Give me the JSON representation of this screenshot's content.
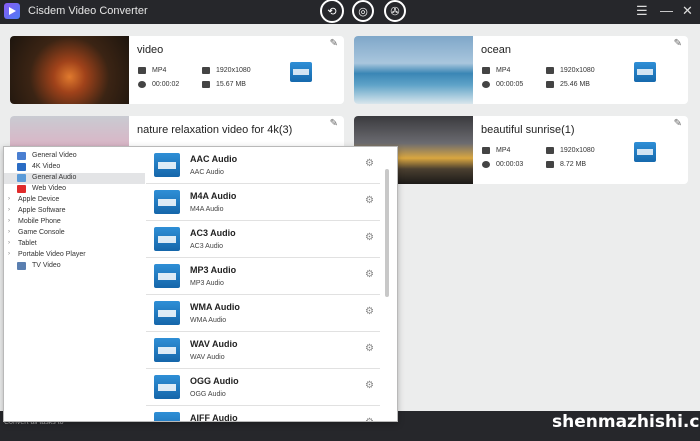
{
  "app": {
    "title": "Cisdem Video Converter"
  },
  "toolbar": {
    "modes": [
      {
        "icon": "convert-icon",
        "glyph": "⟲"
      },
      {
        "icon": "rip-disc-icon",
        "glyph": "◎"
      },
      {
        "icon": "film-reel-icon",
        "glyph": "✇"
      }
    ],
    "menu_glyph": "☰",
    "minimize_glyph": "—",
    "close_glyph": "✕"
  },
  "cards": [
    {
      "title": "video",
      "format": "MP4",
      "resolution": "1920x1080",
      "duration": "00:00:02",
      "size": "15.67 MB"
    },
    {
      "title": "ocean",
      "format": "MP4",
      "resolution": "1920x1080",
      "duration": "00:00:05",
      "size": "25.46 MB"
    },
    {
      "title": "nature relaxation video for 4k(3)"
    },
    {
      "title": "beautiful sunrise(1)",
      "format": "MP4",
      "resolution": "1920x1080",
      "duration": "00:00:03",
      "size": "8.72 MB"
    }
  ],
  "categories": [
    {
      "label": "General Video",
      "icon": "film-icon",
      "color": "#4a7fd1",
      "arrow": ""
    },
    {
      "label": "4K Video",
      "icon": "4k-icon",
      "color": "#2a6cc4",
      "arrow": ""
    },
    {
      "label": "General Audio",
      "icon": "music-note-icon",
      "color": "#5b9bd8",
      "arrow": ""
    },
    {
      "label": "Web Video",
      "icon": "youtube-icon",
      "color": "#e02b2b",
      "arrow": ""
    },
    {
      "label": "Apple Device",
      "icon": "",
      "color": "",
      "arrow": "›"
    },
    {
      "label": "Apple Software",
      "icon": "",
      "color": "",
      "arrow": "›"
    },
    {
      "label": "Mobile Phone",
      "icon": "",
      "color": "",
      "arrow": "›"
    },
    {
      "label": "Game Console",
      "icon": "",
      "color": "",
      "arrow": "›"
    },
    {
      "label": "Tablet",
      "icon": "",
      "color": "",
      "arrow": "›"
    },
    {
      "label": "Portable Video Player",
      "icon": "",
      "color": "",
      "arrow": "›"
    },
    {
      "label": "TV Video",
      "icon": "tv-icon",
      "color": "#5a7fb0",
      "arrow": ""
    }
  ],
  "selected_category": "General Audio",
  "formats": [
    {
      "name": "AAC Audio",
      "sub": "AAC Audio"
    },
    {
      "name": "M4A Audio",
      "sub": "M4A Audio"
    },
    {
      "name": "AC3 Audio",
      "sub": "AC3 Audio"
    },
    {
      "name": "MP3 Audio",
      "sub": "MP3 Audio"
    },
    {
      "name": "WMA Audio",
      "sub": "WMA Audio"
    },
    {
      "name": "WAV Audio",
      "sub": "WAV Audio"
    },
    {
      "name": "OGG Audio",
      "sub": "OGG Audio"
    },
    {
      "name": "AIFF Audio",
      "sub": ""
    }
  ],
  "gear_glyph": "⚙",
  "edit_glyph": "✎",
  "footer": {
    "convert_label": "Convert all tasks to",
    "watermark": "shenmazhishi.com"
  }
}
